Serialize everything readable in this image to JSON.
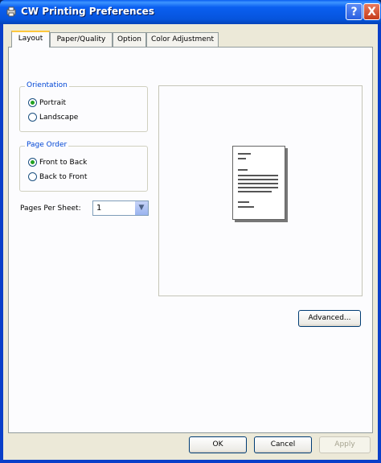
{
  "window": {
    "title": "CW Printing Preferences",
    "help": "?",
    "close": "X"
  },
  "tabs": [
    {
      "label": "Layout"
    },
    {
      "label": "Paper/Quality"
    },
    {
      "label": "Option"
    },
    {
      "label": "Color Adjustment"
    }
  ],
  "orientation": {
    "title": "Orientation",
    "options": [
      {
        "label": "Portrait",
        "checked": true
      },
      {
        "label": "Landscape",
        "checked": false
      }
    ]
  },
  "page_order": {
    "title": "Page Order",
    "options": [
      {
        "label": "Front to Back",
        "checked": true
      },
      {
        "label": "Back to Front",
        "checked": false
      }
    ]
  },
  "pages_per_sheet": {
    "label": "Pages Per Sheet:",
    "value": "1",
    "arrow": "▼"
  },
  "buttons": {
    "advanced": "Advanced...",
    "ok": "OK",
    "cancel": "Cancel",
    "apply": "Apply"
  }
}
